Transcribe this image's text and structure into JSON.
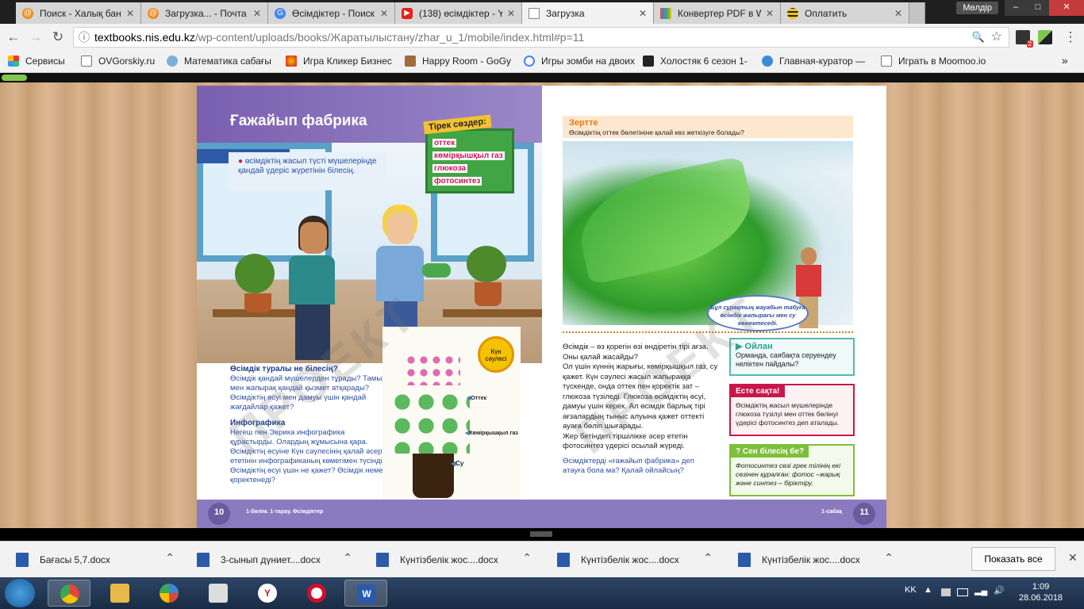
{
  "browser": {
    "tabs": [
      {
        "title": "Поиск - Халық бан",
        "icon_color": "#f28c1c"
      },
      {
        "title": "Загрузка... - Почта",
        "icon_color": "#f28c1c"
      },
      {
        "title": "Өсімдіктер - Поиск",
        "icon_color": "#4285f4"
      },
      {
        "title": "(138) өсімдіктер - Y",
        "icon_color": "#e62117"
      },
      {
        "title": "Загрузка",
        "icon_color": "#888888"
      },
      {
        "title": "Конвертер PDF в W",
        "icon_color": "#e54f2f"
      },
      {
        "title": "Оплатить",
        "icon_color": "#f5c400"
      }
    ],
    "user": "Мөлдір",
    "window_buttons": {
      "minimize": "–",
      "maximize": "□",
      "close": "✕"
    },
    "address": {
      "host": "textbooks.nis.edu.kz",
      "path": "/wp-content/uploads/books/Жаратылыстану/zhar_u_1/mobile/index.html#p=11"
    },
    "nav": {
      "back": "←",
      "forward": "→",
      "reload": "↻",
      "info": "ⓘ",
      "zoom": "🔍",
      "star": "☆",
      "menu": "⋮"
    },
    "ext_badge": "2",
    "bookmarks": [
      {
        "label": "Сервисы",
        "icon": "apps-icon"
      },
      {
        "label": "OVGorskiy.ru",
        "icon": "page-icon"
      },
      {
        "label": "Математика сабағы",
        "icon": "globe-icon"
      },
      {
        "label": "Игра Кликер Бизнес",
        "icon": "game-icon"
      },
      {
        "label": "Happy Room - GoGy",
        "icon": "game-icon"
      },
      {
        "label": "Игры зомби на двоих",
        "icon": "google-icon"
      },
      {
        "label": "Холостяк 6 сезон 1-",
        "icon": "k-icon"
      },
      {
        "label": "Главная-куратор —",
        "icon": "globe-icon"
      },
      {
        "label": "Играть в Moomoo.io",
        "icon": "page-icon"
      }
    ],
    "bookmarks_more": "»"
  },
  "book": {
    "left": {
      "title": "Ғажайып фабрика",
      "sen_label": "Сен",
      "sen_text": "өсімдіктің жасыл түсті мүшелерінде қандай үдеріс жүретінін білесің.",
      "keywords_header": "Тірек сөздер:",
      "keywords": [
        "оттек",
        "көмірқышқыл газ",
        "глюкоза",
        "фотосинтез"
      ],
      "q_header": "Өсімдік туралы не білесің?",
      "q_text": "Өсімдік қандай мүшелерден тұрады? Тамыр мен жапырақ қандай қызмет атқарады? Өсімдіктің өсуі мен дамуы үшін қандай жағдайлар қажет?",
      "info_header": "Инфографика",
      "info_text": "Негеш пен Эврика инфографика құрастырды. Олардың жұмысына қара. Өсімдіктің өсуіне Күн сәулесінің қалай әсер ететінін инфографиканың көмегімен түсіндір. Өсімдіктің өсуі үшін не қажет? Өсімдік немен қоректенеді?",
      "sun_label": "Күн сәулесі",
      "arrow_oxygen": "Оттек",
      "arrow_co2": "Көмірқышқыл газ",
      "arrow_water": "Су",
      "page_number": "10",
      "footer": "1-бөлім. 1-тарау. Өсімдіктер"
    },
    "right": {
      "zertte_header": "Зертте",
      "zertte_question": "Өсімдіктің оттек бөлетініне қалай көз жеткізуге болады?",
      "bubble": "Бұл сұрақтың жауабын табуға өсімдік жапырағы мен су көмектеседі.",
      "main_p1": "Өсімдік – өз қорегін өзі өндіретін тірі ағза. Оны қалай жасайды?",
      "main_p2": "Ол үшін күннің жарығы, көмірқышқыл газ, су қажет. Күн сәулесі жасыл жапыраққа түскенде, онда оттек пен қоректік зат – глюкоза түзіледі. Глюкоза өсімдіктің өсуі, дамуы үшін керек. Ал өсімдік барлық тірі ағзалардың тыныс алуына қажет оттекті ауаға бөліп шығарады.",
      "main_p3": "Жер бетіндегі тіршілікке әсер ететін фотосинтез үдерісі осылай жүреді.",
      "main_q": "Өсімдіктерді «ғажайып фабрика» деп атауға бола ма? Қалай ойлайсың?",
      "oilan_header": "Ойлан",
      "oilan_text": "Ормандa, саябақта серуендеу неліктен пайдалы?",
      "este_header": "Есте сақта!",
      "este_text": "Өсімдіктің жасыл мүшелерінде глюкоза түзілуі мен оттек бөлінуі үдерісі фотосинтез деп аталады.",
      "bilesing_header": "Сен білесің бе?",
      "bilesing_text": "Фотосинтез сөзі грек тілінің екі сөзінен құралған: фотос –жарық және синтез – біріктіру.",
      "page_number": "11",
      "footer": "1-сабақ"
    },
    "watermark": "ПРОЕКТ"
  },
  "downloads": {
    "items": [
      "Бағасы  5,7.docx",
      "3-сынып дүниет....docx",
      "Күнтізбелік жос....docx",
      "Күнтізбелік жос....docx",
      "Күнтізбелік жос....docx"
    ],
    "show_all": "Показать все",
    "close": "✕"
  },
  "taskbar": {
    "apps": [
      {
        "name": "chrome",
        "color": "#e0463a"
      },
      {
        "name": "explorer",
        "color": "#e9b84a"
      },
      {
        "name": "ball",
        "color": "#3b86d6"
      },
      {
        "name": "video",
        "color": "#dddddd"
      },
      {
        "name": "yandex",
        "color": "#ffffff"
      },
      {
        "name": "opera",
        "color": "#d0102a"
      },
      {
        "name": "word",
        "color": "#2b5aaa"
      }
    ],
    "lang": "KK",
    "time": "1:09",
    "date": "28.06.2018"
  }
}
